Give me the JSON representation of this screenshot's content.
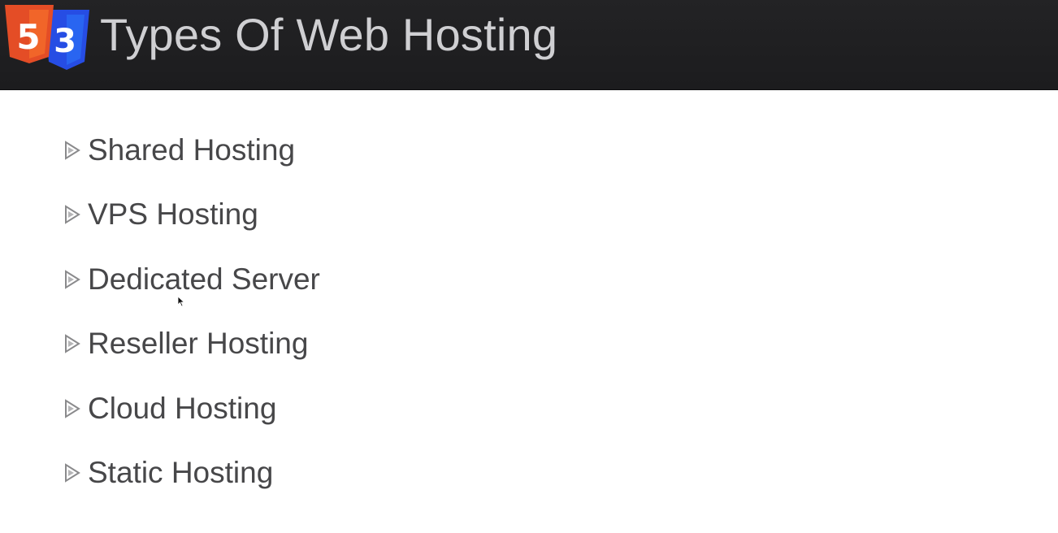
{
  "header": {
    "logo_icon": "html5-css3-logo-icon",
    "logo_text_html": "5",
    "logo_text_css": "3",
    "title": "Types Of Web Hosting"
  },
  "main": {
    "bullet_icon": "triangle-bullet-icon",
    "items": [
      {
        "label": "Shared Hosting"
      },
      {
        "label": "VPS Hosting"
      },
      {
        "label": "Dedicated Server"
      },
      {
        "label": "Reseller Hosting"
      },
      {
        "label": "Cloud Hosting"
      },
      {
        "label": "Static Hosting"
      }
    ]
  },
  "colors": {
    "header_bg": "#1e1e20",
    "title_text": "#cfcfd2",
    "item_text": "#474749",
    "html5_orange": "#e44d26",
    "css3_blue": "#2965f1",
    "bullet_gray": "#8a8a8c"
  }
}
